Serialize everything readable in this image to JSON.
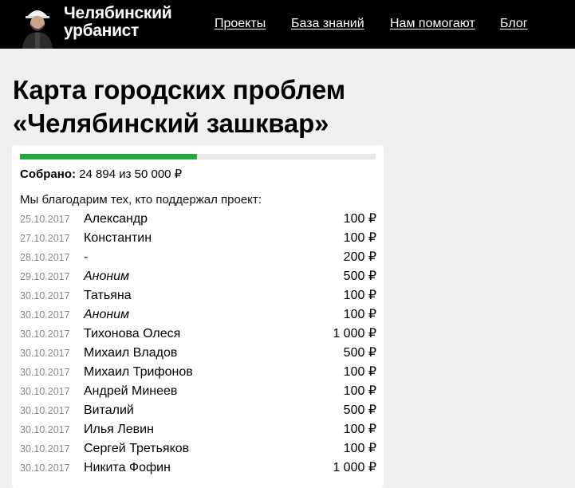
{
  "header": {
    "logo_line1": "Челябинский",
    "logo_line2": "урбанист",
    "nav": [
      {
        "label": "Проекты"
      },
      {
        "label": "База знаний"
      },
      {
        "label": "Нам помогают"
      },
      {
        "label": "Блог"
      }
    ]
  },
  "page": {
    "title_line1": "Карта городских проблем",
    "title_line2": "«Челябинский зашквар»"
  },
  "fundraiser": {
    "collected_label": "Собрано:",
    "collected_value": "24 894 из 50 000 ₽",
    "progress_fraction": 0.498,
    "progress_color": "#21a93a",
    "thanks_text": "Мы благодарим тех, кто поддержал проект:",
    "donors": [
      {
        "date": "25.10.2017",
        "name": "Александр",
        "amount": "100 ₽",
        "anon": false
      },
      {
        "date": "27.10.2017",
        "name": "Константин",
        "amount": "100 ₽",
        "anon": false
      },
      {
        "date": "28.10.2017",
        "name": "-",
        "amount": "200 ₽",
        "anon": false
      },
      {
        "date": "29.10.2017",
        "name": "Аноним",
        "amount": "500 ₽",
        "anon": true
      },
      {
        "date": "30.10.2017",
        "name": "Татьяна",
        "amount": "100 ₽",
        "anon": false
      },
      {
        "date": "30.10.2017",
        "name": "Аноним",
        "amount": "100 ₽",
        "anon": true
      },
      {
        "date": "30.10.2017",
        "name": "Тихонова Олеся",
        "amount": "1 000 ₽",
        "anon": false
      },
      {
        "date": "30.10.2017",
        "name": "Михаил Владов",
        "amount": "500 ₽",
        "anon": false
      },
      {
        "date": "30.10.2017",
        "name": "Михаил Трифонов",
        "amount": "100 ₽",
        "anon": false
      },
      {
        "date": "30.10.2017",
        "name": "Андрей Минеев",
        "amount": "100 ₽",
        "anon": false
      },
      {
        "date": "30.10.2017",
        "name": "Виталий",
        "amount": "500 ₽",
        "anon": false
      },
      {
        "date": "30.10.2017",
        "name": "Илья Левин",
        "amount": "100 ₽",
        "anon": false
      },
      {
        "date": "30.10.2017",
        "name": "Сергей Третьяков",
        "amount": "100 ₽",
        "anon": false
      },
      {
        "date": "30.10.2017",
        "name": "Никита Фофин",
        "amount": "1 000 ₽",
        "anon": false
      }
    ]
  }
}
